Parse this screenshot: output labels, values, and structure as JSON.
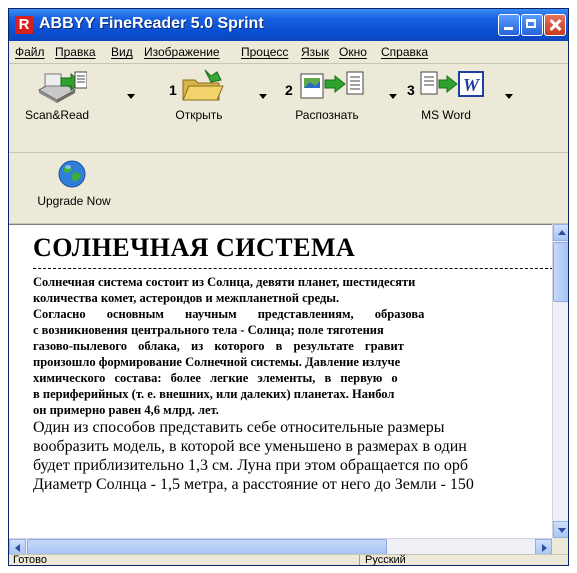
{
  "window": {
    "title": "ABBYY FineReader 5.0 Sprint",
    "app_icon_letter": "R"
  },
  "menu": [
    "Файл",
    "Правка",
    "Вид",
    "Изображение",
    "Процесс",
    "Язык",
    "Окно",
    "Справка"
  ],
  "toolbar": {
    "scan_read": "Scan&Read",
    "open": {
      "num": "1",
      "label": "Открыть"
    },
    "recognize": {
      "num": "2",
      "label": "Распознать"
    },
    "msword": {
      "num": "3",
      "label": "MS Word"
    },
    "upgrade": "Upgrade Now"
  },
  "document": {
    "title": "СОЛНЕЧНАЯ СИСТЕМА",
    "bold_lines": [
      "Солнечная система состоит из Солнца, девяти планет, шестидесяти",
      "количества комет, астероидов и межпланетной среды.",
      "Согласно основным научным представлениям, образова",
      "с возникновения центрального тела - Солнца; поле тяготения",
      "газово-пылевого облака, из которого в результате гравит",
      "произошло формирование Солнечной системы. Давление излуче",
      "химического состава: более легкие элементы, в первую о",
      "в периферийных (т. е. внешних, или далеких) планетах. Наибол",
      "он примерно равен 4,6 млрд. лет."
    ],
    "regular_lines": [
      "Один из способов представить себе относительные размеры",
      "вообразить модель, в которой все уменьшено в размерах в один",
      "будет приблизительно 1,3 см. Луна при этом обращается по орб",
      "Диаметр Солнца - 1,5 метра, а расстояние от него до Земли - 150"
    ]
  },
  "status": {
    "left": "Готово",
    "right": "Русский"
  },
  "colors": {
    "titlebar": "#0a4fd1",
    "window_bg": "#ece9d8",
    "close_button": "#c53c1f"
  }
}
